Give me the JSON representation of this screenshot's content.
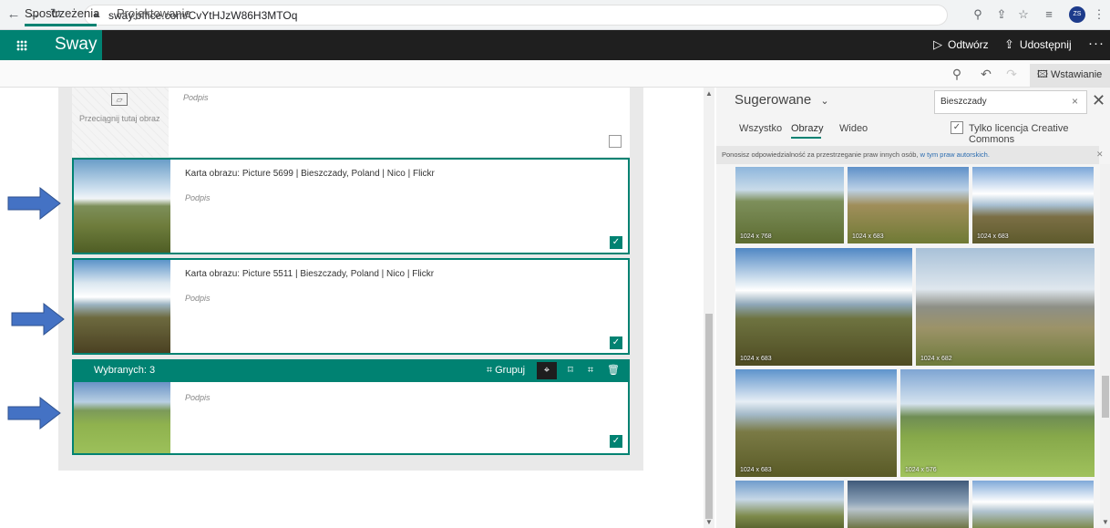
{
  "browser": {
    "url": "sway.office.com/CvYtHJzW86H3MTOq",
    "profile_initials": "ZS"
  },
  "app": {
    "brand": "Sway",
    "play_label": "Odtwórz",
    "share_label": "Udostępnij",
    "more_label": "···"
  },
  "tabs": {
    "insights": "Spostrzeżenia",
    "design": "Projektowanie",
    "insert": "Wstawianie"
  },
  "storyline": {
    "placeholder": {
      "caption": "Podpis",
      "drop_text": "Przeciągnij tutaj obraz"
    },
    "cards": [
      {
        "title": "Karta obrazu: Picture 5699 | Bieszczady, Poland | Nico | Flickr",
        "caption": "Podpis",
        "checked": true
      },
      {
        "title": "Karta obrazu: Picture 5511 | Bieszczady, Poland | Nico | Flickr",
        "caption": "Podpis",
        "checked": true
      },
      {
        "title": "",
        "caption": "Podpis",
        "checked": true
      }
    ],
    "selected_bar": {
      "count_label": "Wybranych: 3",
      "group_label": "Grupuj"
    }
  },
  "panel": {
    "suggested_label": "Sugerowane",
    "search_value": "Bieszczady",
    "filter_tabs": [
      "Wszystko",
      "Obrazy",
      "Wideo"
    ],
    "active_filter": "Obrazy",
    "cc_label": "Tylko licencja Creative Commons",
    "notice_text": "Ponosisz odpowiedzialność za przestrzeganie praw innych osób,",
    "notice_link": "w tym praw autorskich.",
    "images": [
      {
        "dims": "1024 x 768"
      },
      {
        "dims": "1024 x 683"
      },
      {
        "dims": "1024 x 683"
      },
      {
        "dims": "1024 x 683"
      },
      {
        "dims": "1024 x 682"
      },
      {
        "dims": "1024 x 683"
      },
      {
        "dims": "1024 x 576"
      }
    ]
  },
  "colors": {
    "accent": "#008272",
    "arrow": "#4472c4"
  }
}
